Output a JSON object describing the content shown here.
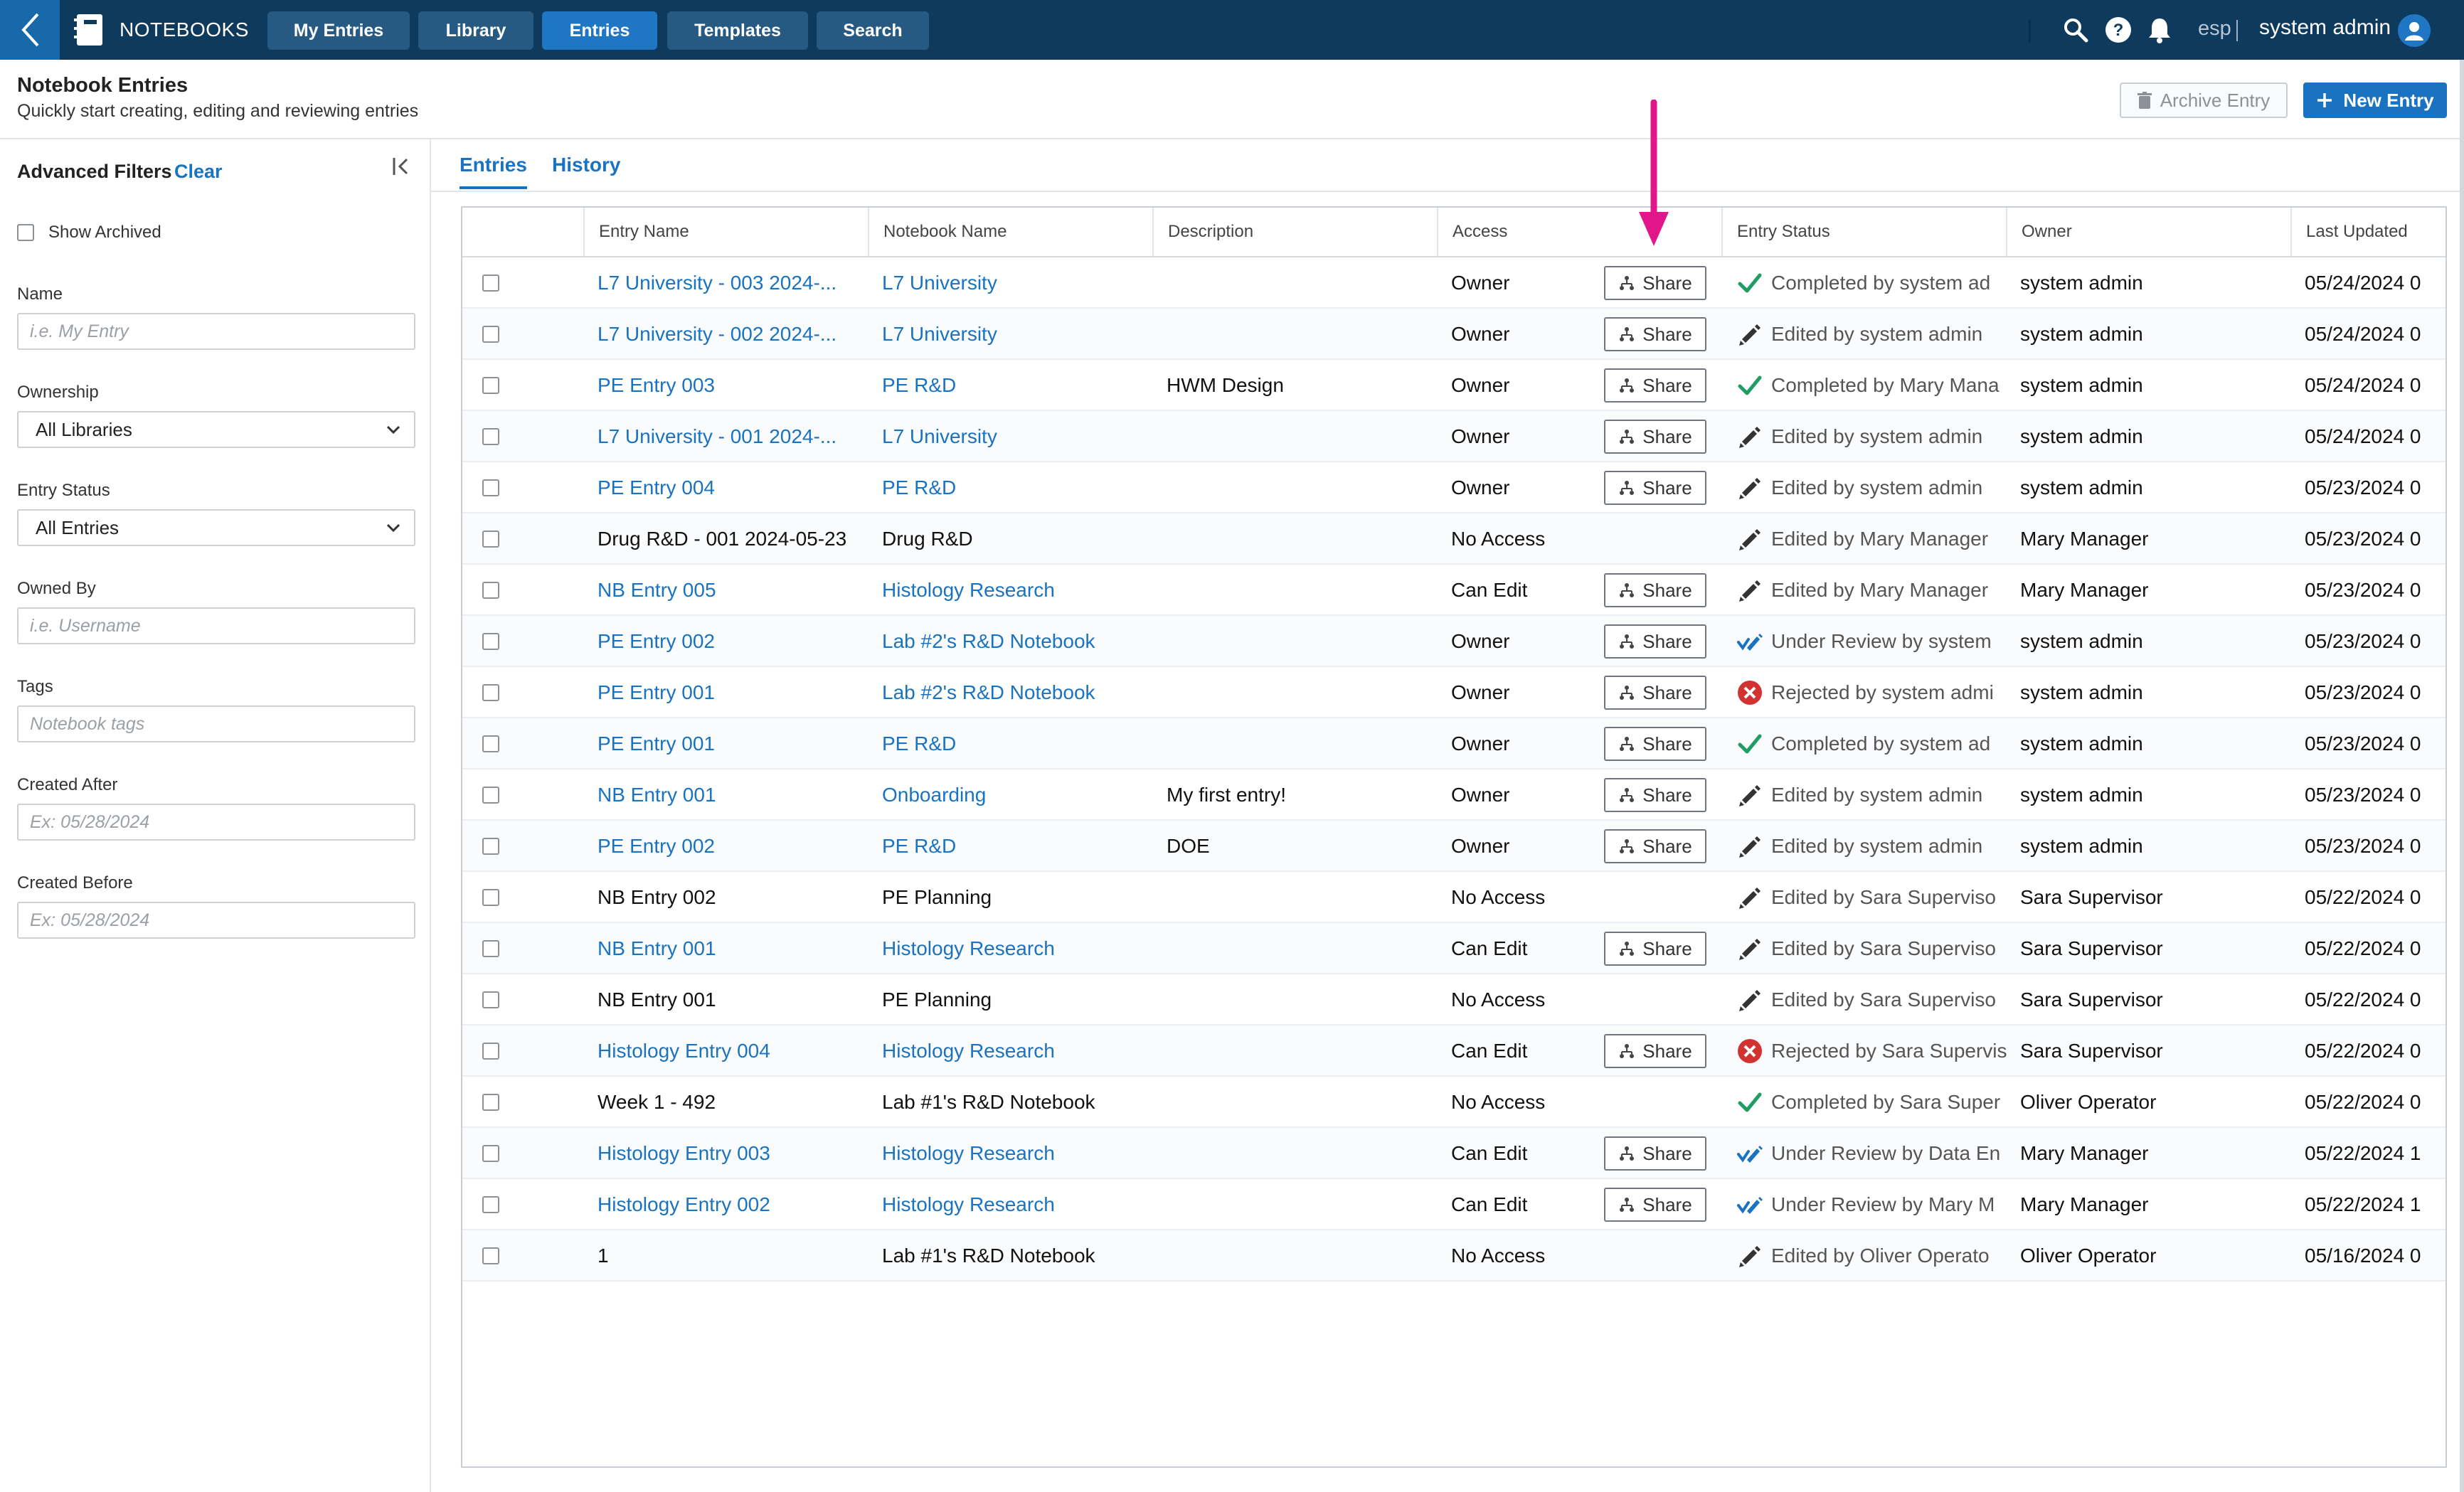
{
  "topnav": {
    "brand": "NOTEBOOKS",
    "tabs": [
      {
        "label": "My Entries"
      },
      {
        "label": "Library"
      },
      {
        "label": "Entries"
      },
      {
        "label": "Templates"
      },
      {
        "label": "Search"
      }
    ],
    "active_tab": "Entries",
    "language": "esp",
    "user": "system admin"
  },
  "header": {
    "title": "Notebook Entries",
    "subtitle": "Quickly start creating, editing and reviewing entries",
    "archive_label": "Archive Entry",
    "new_entry_label": "New Entry"
  },
  "filters": {
    "title": "Advanced Filters",
    "clear": "Clear",
    "show_archived": "Show Archived",
    "name_label": "Name",
    "name_placeholder": "i.e. My Entry",
    "ownership_label": "Ownership",
    "ownership_value": "All Libraries",
    "entry_status_label": "Entry Status",
    "entry_status_value": "All Entries",
    "owned_by_label": "Owned By",
    "owned_by_placeholder": "i.e. Username",
    "tags_label": "Tags",
    "tags_placeholder": "Notebook tags",
    "created_after_label": "Created After",
    "created_after_placeholder": "Ex: 05/28/2024",
    "created_before_label": "Created Before",
    "created_before_placeholder": "Ex: 05/28/2024"
  },
  "tabs": {
    "entries": "Entries",
    "history": "History"
  },
  "table": {
    "columns": [
      "Entry Name",
      "Notebook Name",
      "Description",
      "Access",
      "Entry Status",
      "Owner",
      "Last Updated"
    ],
    "share_label": "Share",
    "rows": [
      {
        "entry": "L7 University - 003 2024-...",
        "notebook": "L7 University",
        "description": "",
        "access": "Owner",
        "share": true,
        "status_icon": "check",
        "status": "Completed by system ad",
        "owner": "system admin",
        "updated": "05/24/2024 0",
        "link": true
      },
      {
        "entry": "L7 University - 002 2024-...",
        "notebook": "L7 University",
        "description": "",
        "access": "Owner",
        "share": true,
        "status_icon": "pencil",
        "status": "Edited by system admin",
        "owner": "system admin",
        "updated": "05/24/2024 0",
        "link": true
      },
      {
        "entry": "PE Entry 003",
        "notebook": "PE R&D",
        "description": "HWM Design",
        "access": "Owner",
        "share": true,
        "status_icon": "check",
        "status": "Completed by Mary Mana",
        "owner": "system admin",
        "updated": "05/24/2024 0",
        "link": true
      },
      {
        "entry": "L7 University - 001 2024-...",
        "notebook": "L7 University",
        "description": "",
        "access": "Owner",
        "share": true,
        "status_icon": "pencil",
        "status": "Edited by system admin",
        "owner": "system admin",
        "updated": "05/24/2024 0",
        "link": true
      },
      {
        "entry": "PE Entry 004",
        "notebook": "PE R&D",
        "description": "",
        "access": "Owner",
        "share": true,
        "status_icon": "pencil",
        "status": "Edited by system admin",
        "owner": "system admin",
        "updated": "05/23/2024 0",
        "link": true
      },
      {
        "entry": "Drug R&D - 001 2024-05-23",
        "notebook": "Drug R&D",
        "description": "",
        "access": "No Access",
        "share": false,
        "status_icon": "pencil",
        "status": "Edited by Mary Manager",
        "owner": "Mary Manager",
        "updated": "05/23/2024 0",
        "link": false
      },
      {
        "entry": "NB Entry 005",
        "notebook": "Histology Research",
        "description": "",
        "access": "Can Edit",
        "share": true,
        "status_icon": "pencil",
        "status": "Edited by Mary Manager",
        "owner": "Mary Manager",
        "updated": "05/23/2024 0",
        "link": true
      },
      {
        "entry": "PE Entry 002",
        "notebook": "Lab #2's R&D Notebook",
        "description": "",
        "access": "Owner",
        "share": true,
        "status_icon": "review",
        "status": "Under Review by system",
        "owner": "system admin",
        "updated": "05/23/2024 0",
        "link": true
      },
      {
        "entry": "PE Entry 001",
        "notebook": "Lab #2's R&D Notebook",
        "description": "",
        "access": "Owner",
        "share": true,
        "status_icon": "rejected",
        "status": "Rejected by system admi",
        "owner": "system admin",
        "updated": "05/23/2024 0",
        "link": true
      },
      {
        "entry": "PE Entry 001",
        "notebook": "PE R&D",
        "description": "",
        "access": "Owner",
        "share": true,
        "status_icon": "check",
        "status": "Completed by system ad",
        "owner": "system admin",
        "updated": "05/23/2024 0",
        "link": true
      },
      {
        "entry": "NB Entry 001",
        "notebook": "Onboarding",
        "description": "My first entry!",
        "access": "Owner",
        "share": true,
        "status_icon": "pencil",
        "status": "Edited by system admin",
        "owner": "system admin",
        "updated": "05/23/2024 0",
        "link": true
      },
      {
        "entry": "PE Entry 002",
        "notebook": "PE R&D",
        "description": "DOE",
        "access": "Owner",
        "share": true,
        "status_icon": "pencil",
        "status": "Edited by system admin",
        "owner": "system admin",
        "updated": "05/23/2024 0",
        "link": true
      },
      {
        "entry": "NB Entry 002",
        "notebook": "PE Planning",
        "description": "",
        "access": "No Access",
        "share": false,
        "status_icon": "pencil",
        "status": "Edited by Sara Superviso",
        "owner": "Sara Supervisor",
        "updated": "05/22/2024 0",
        "link": false
      },
      {
        "entry": "NB Entry 001",
        "notebook": "Histology Research",
        "description": "",
        "access": "Can Edit",
        "share": true,
        "status_icon": "pencil",
        "status": "Edited by Sara Superviso",
        "owner": "Sara Supervisor",
        "updated": "05/22/2024 0",
        "link": true
      },
      {
        "entry": "NB Entry 001",
        "notebook": "PE Planning",
        "description": "",
        "access": "No Access",
        "share": false,
        "status_icon": "pencil",
        "status": "Edited by Sara Superviso",
        "owner": "Sara Supervisor",
        "updated": "05/22/2024 0",
        "link": false
      },
      {
        "entry": "Histology Entry 004",
        "notebook": "Histology Research",
        "description": "",
        "access": "Can Edit",
        "share": true,
        "status_icon": "rejected",
        "status": "Rejected by Sara Supervis",
        "owner": "Sara Supervisor",
        "updated": "05/22/2024 0",
        "link": true
      },
      {
        "entry": "Week 1 - 492",
        "notebook": "Lab #1's R&D Notebook",
        "description": "",
        "access": "No Access",
        "share": false,
        "status_icon": "check",
        "status": "Completed by Sara Super",
        "owner": "Oliver Operator",
        "updated": "05/22/2024 0",
        "link": false
      },
      {
        "entry": "Histology Entry 003",
        "notebook": "Histology Research",
        "description": "",
        "access": "Can Edit",
        "share": true,
        "status_icon": "review",
        "status": "Under Review by Data En",
        "owner": "Mary Manager",
        "updated": "05/22/2024 1",
        "link": true
      },
      {
        "entry": "Histology Entry 002",
        "notebook": "Histology Research",
        "description": "",
        "access": "Can Edit",
        "share": true,
        "status_icon": "review",
        "status": "Under Review by Mary M",
        "owner": "Mary Manager",
        "updated": "05/22/2024 1",
        "link": true
      },
      {
        "entry": "1",
        "notebook": "Lab #1's R&D Notebook",
        "description": "",
        "access": "No Access",
        "share": false,
        "status_icon": "pencil",
        "status": "Edited by Oliver Operato",
        "owner": "Oliver Operator",
        "updated": "05/16/2024 0",
        "link": false
      }
    ]
  },
  "colors": {
    "nav_bg": "#0e3a5e",
    "accent": "#1a73c0",
    "check": "#1f9d63",
    "rejected": "#d23232",
    "annotation_arrow": "#e0168a"
  }
}
